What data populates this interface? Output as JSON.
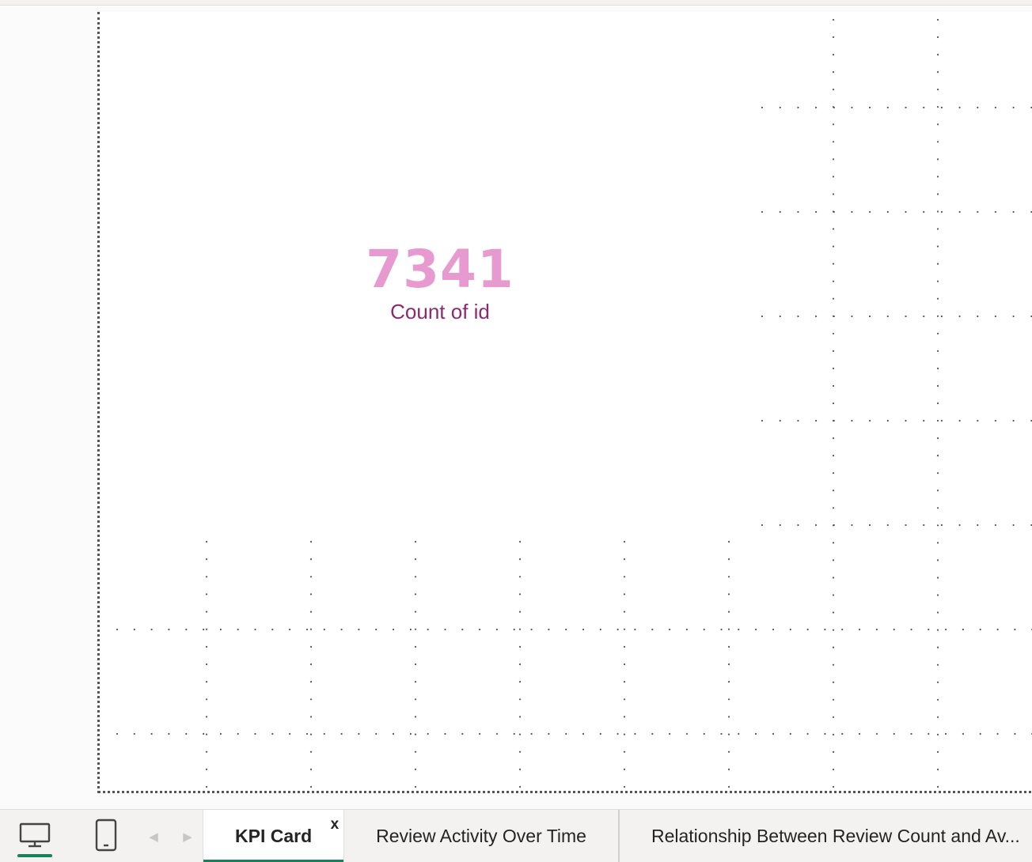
{
  "kpi": {
    "value": "7341",
    "label": "Count of id",
    "value_color": "#e79ad0",
    "label_color": "#8c2a6e"
  },
  "view_toggle": {
    "desktop_icon": "monitor-icon",
    "mobile_icon": "phone-icon",
    "active": "desktop"
  },
  "nav": {
    "prev_icon": "caret-left-icon",
    "next_icon": "caret-right-icon"
  },
  "tabs": [
    {
      "label": "KPI Card",
      "active": true,
      "close_label": "x"
    },
    {
      "label": "Review Activity Over Time",
      "active": false
    },
    {
      "label": "Relationship Between Review Count and Av...",
      "active": false
    }
  ],
  "colors": {
    "accent": "#1a7f5a",
    "grid_dot": "#555555"
  }
}
